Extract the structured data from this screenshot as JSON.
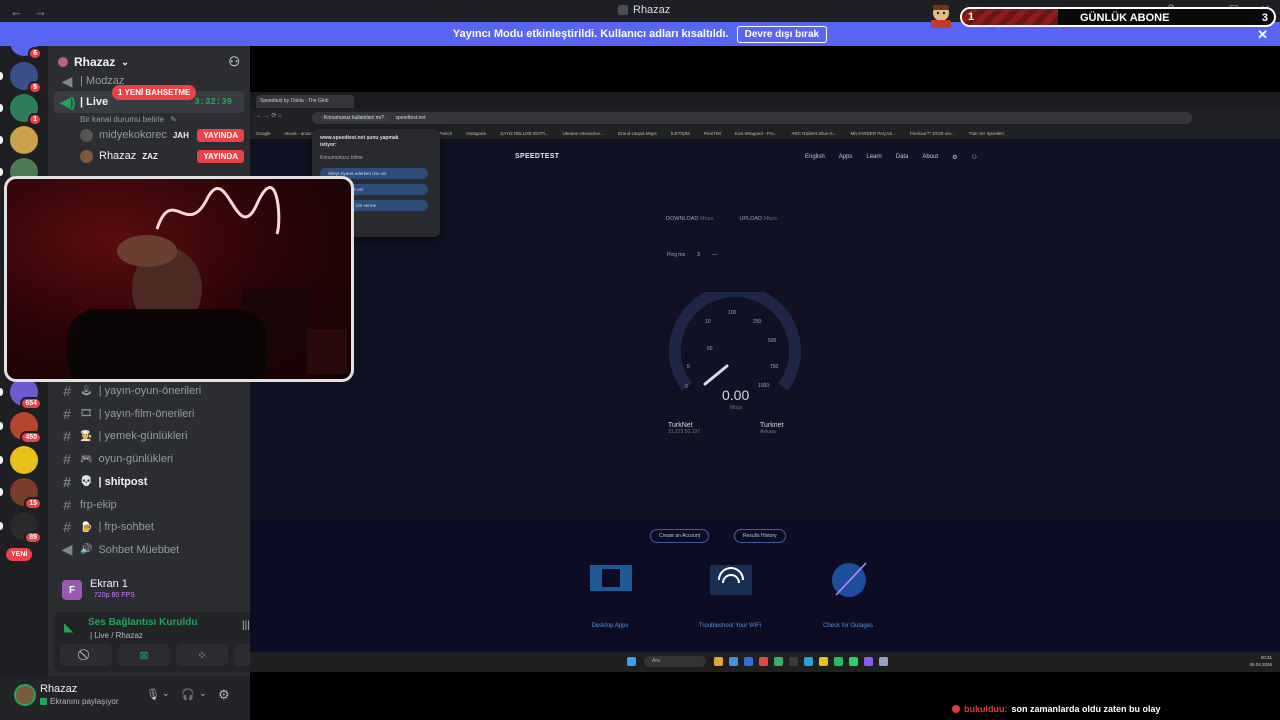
{
  "window": {
    "title": "Rhazaz",
    "back_icon": "←",
    "forward_icon": "→",
    "controls": [
      "?",
      "—",
      "☐",
      "✕"
    ]
  },
  "sub_goal": {
    "current": "1",
    "label": "GÜNLÜK ABONE",
    "target": "3",
    "progress_fraction": 0.33
  },
  "banner": {
    "text": "Yayıncı Modu etkinleştirildi. Kullanıcı adları kısaltıldı.",
    "button": "Devre dışı bırak",
    "close": "✕"
  },
  "rail": {
    "servers": [
      {
        "badge": "6",
        "color": "#5865f2"
      },
      {
        "badge": "5",
        "color": "#3a4f8a"
      },
      {
        "badge": "1",
        "color": "#2e7d5b"
      },
      {
        "badge": "",
        "color": "#c9a14a"
      },
      {
        "badge": "",
        "color": "#4c7a57"
      },
      {
        "badge": "654",
        "color": "#6d5bd0"
      },
      {
        "badge": "450",
        "color": "#b5452c"
      },
      {
        "badge": "",
        "color": "#e8c21a"
      },
      {
        "badge": "15",
        "color": "#7a3b2a"
      },
      {
        "badge": "89",
        "color": "#2a2a2a"
      }
    ],
    "new_label": "YENİ"
  },
  "sidebar": {
    "server_name": "Rhazaz",
    "mention_pill": "1 YENİ BAHSETME",
    "top_channel": "| Modzaz",
    "voice_channel": "| Live",
    "voice_timer": "3:32:39",
    "status_prompt": "Bir kanal durumu belirle",
    "voice_users": [
      {
        "name": "midyekokorec",
        "tag": "JAH",
        "live": "YAYINDA"
      },
      {
        "name": "Rhazaz",
        "tag": "ZAZ",
        "live": "YAYINDA"
      }
    ],
    "channels": [
      {
        "emoji": "🕹",
        "name": "| yayın-oyun-önerileri",
        "bold": false
      },
      {
        "emoji": "🎞",
        "name": "| yayın-film-önerileri",
        "bold": false
      },
      {
        "emoji": "👨‍🍳",
        "name": "| yemek-günlükleri",
        "bold": false
      },
      {
        "emoji": "🎮",
        "name": "oyun-günlükleri",
        "bold": false
      },
      {
        "emoji": "💀",
        "name": "| shitpost",
        "bold": true
      },
      {
        "emoji": "",
        "name": "frp-ekip",
        "bold": false
      },
      {
        "emoji": "🍺",
        "name": "| frp-sohbet",
        "bold": false
      },
      {
        "emoji": "🔊",
        "name": "Sohbet Müebbet",
        "bold": false
      }
    ]
  },
  "voice_panel": {
    "screen_title": "Ekran 1",
    "screen_quality": "720p 60 FPS",
    "connection_title": "Ses Bağlantısı Kuruldu",
    "connection_channel": "| Live / Rhazaz"
  },
  "user": {
    "name": "Rhazaz",
    "status": "Ekranını paylaşıyor"
  },
  "shared_screen": {
    "tab_title": "Speedtest by Ookla - The Glob",
    "url": "speedtest.net",
    "permission": {
      "chip": "Konumunuz kullanılsın mı?",
      "site": "www.speedtest.net şunu yapmak istiyor:",
      "request": "Konumunuzu bilme",
      "options": [
        "Siteyi ziyaret ederken izin ver",
        "Bu defalık izin ver",
        "Hiçbir zaman izin verme"
      ]
    },
    "bookmarks": [
      "Google",
      "ebook - amazo...",
      "Netflix",
      "YouTube - Broadcas...",
      "Kick",
      "Twitch",
      "Instagram",
      "ZAYIZ DELUXE EDITI...",
      "Ukraine Interactive...",
      "Grand Utopia Maps",
      "İLETİŞİM",
      "FlexiTIM",
      "Kick Wrapped - Pro...",
      "ARC Raiders Blue G...",
      "MİLYARDER PAÇAS...",
      "Packout™ 10/28 om...",
      "Tüm Yer İşaretleri"
    ],
    "speedtest": {
      "logo": "SPEEDTEST",
      "menu": [
        "English",
        "Apps",
        "Learn",
        "Data",
        "About"
      ],
      "download_label": "DOWNLOAD",
      "upload_label": "UPLOAD",
      "unit": "Mbps",
      "ping_label": "Ping",
      "ping_unit": "ms",
      "ping_value": "3",
      "ping_dash": "—",
      "ticks": [
        "0",
        "5",
        "10",
        "50",
        "100",
        "250",
        "500",
        "750",
        "1000"
      ],
      "speed": "0.00",
      "speed_unit": "Mbps",
      "isp": "TurkNet",
      "ip": "31.223.50.197",
      "server": "Turknet",
      "server_city": "Ankara",
      "create_account": "Create an Account",
      "results_history": "Results History",
      "features": [
        "Desktop Apps",
        "Troubleshoot Your WiFi",
        "Check for Outages"
      ]
    },
    "taskbar": {
      "search": "Ara",
      "time": "00:31",
      "date": "06.04.2026"
    }
  },
  "chat": {
    "username": "bukulduu:",
    "message": "son zamanlarda oldu zaten bu olay"
  }
}
